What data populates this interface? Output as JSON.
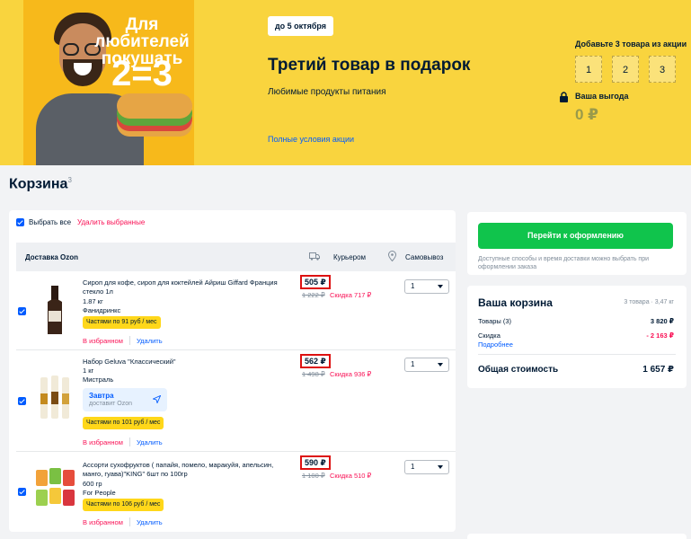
{
  "promo": {
    "image_text_line1": "Для любителей покушать",
    "image_text_line2": "2=3",
    "date_badge": "до 5 октября",
    "title": "Третий товар в подарок",
    "subtitle": "Любимые продукты питания",
    "conditions_link": "Полные условия акции",
    "add_label": "Добавьте 3 товара из акции",
    "slots": [
      "1",
      "2",
      "3"
    ],
    "benefit_label": "Ваша выгода",
    "benefit_value": "0 ₽"
  },
  "cart": {
    "title": "Корзина",
    "count": "3",
    "select_all": "Выбрать все",
    "delete_selected": "Удалить выбранные",
    "delivery_label": "Доставка Ozon",
    "courier_label": "Курьером",
    "pickup_label": "Самовывоз",
    "favorites_label": "В избранном",
    "delete_label": "Удалить",
    "items": [
      {
        "name": "Сироп для кофе, сироп для коктейлей Айриш Giffard Франция стекло 1л",
        "meta1": "1.87 кг",
        "meta2": "Фанидринкс",
        "installment": "Частями по 91 руб / мес",
        "price": "505 ₽",
        "old_price": "1 222 ₽",
        "discount": "Скидка 717 ₽",
        "qty": "1"
      },
      {
        "name": "Набор Geluva \"Классический\"",
        "meta1": "1 кг",
        "meta2": "Мистраль",
        "delivery_day": "Завтра",
        "delivery_by": "доставит Ozon",
        "installment": "Частями по 101 руб / мес",
        "price": "562 ₽",
        "old_price": "1 498 ₽",
        "discount": "Скидка 936 ₽",
        "qty": "1"
      },
      {
        "name": "Ассорти сухофруктов ( папайя, помело, маракуйя, апельсин, манго, гуава)\"KING\" 6шт по 100гр",
        "meta1": "600 гр",
        "meta2": "For People",
        "installment": "Частями по 106 руб / мес",
        "price": "590 ₽",
        "old_price": "1 100 ₽",
        "discount": "Скидка 510 ₽",
        "qty": "1"
      }
    ]
  },
  "checkout": {
    "button": "Перейти к оформлению",
    "note": "Доступные способы и время доставки можно выбрать при оформлении заказа"
  },
  "summary": {
    "title": "Ваша корзина",
    "info": "3 товара · 3,47 кг",
    "goods_label": "Товары (3)",
    "goods_value": "3 820 ₽",
    "discount_label": "Скидка",
    "discount_value": "- 2 163 ₽",
    "more_link": "Подробнее",
    "total_label": "Общая стоимость",
    "total_value": "1 657 ₽"
  },
  "colors": {
    "banner": "#f9d43e",
    "primary_blue": "#005bff",
    "checkout_green": "#10c44c",
    "discount_pink": "#f91155",
    "installment_yellow": "#ffd71a"
  }
}
